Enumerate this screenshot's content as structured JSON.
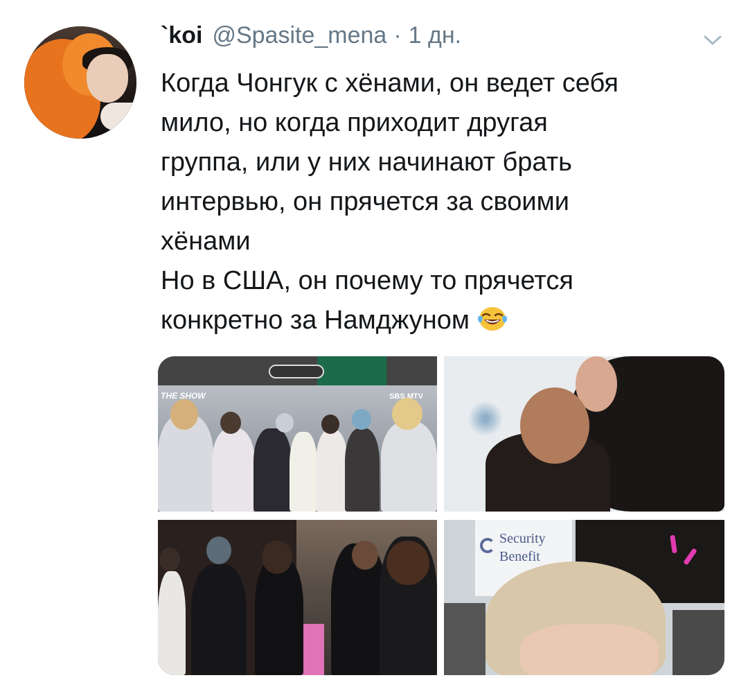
{
  "tweet": {
    "display_name": "`koi",
    "handle": "@Spasite_mena",
    "separator": "·",
    "time": "1 дн.",
    "text_lines": [
      "Когда Чонгук с хёнами, он ведет себя",
      "мило, но когда приходит другая",
      "группа, или у них начинают брать",
      "интервью, он прячется за своими",
      "хёнами",
      "Но в США, он почему то прячется",
      "конкретно за Намджуном"
    ],
    "emoji": "face-with-tears-of-joy"
  },
  "media": {
    "photo1": {
      "logo_left": "THE SHOW",
      "logo_right": "SBS MTV"
    },
    "photo4": {
      "banner_text": "Security\nBenefit"
    }
  },
  "colors": {
    "text": "#14171a",
    "secondary": "#657786",
    "background": "#ffffff"
  },
  "icons": {
    "menu": "chevron-down-icon"
  }
}
